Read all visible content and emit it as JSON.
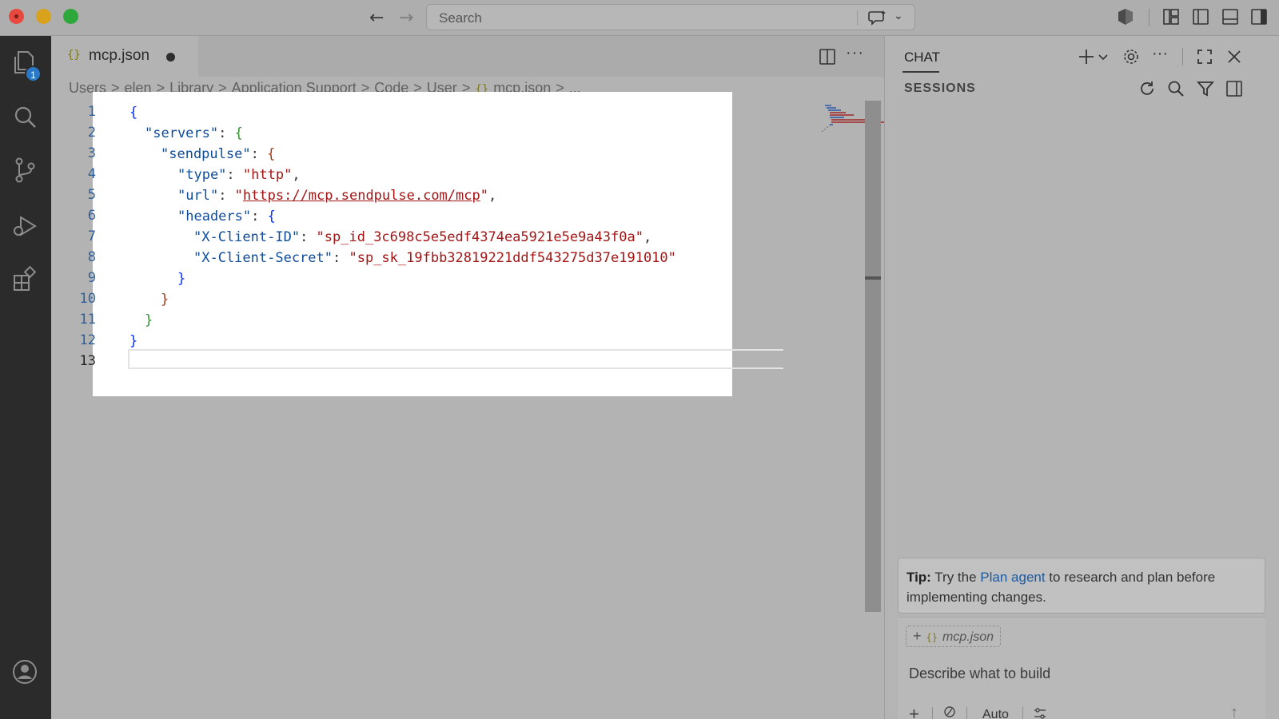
{
  "titlebar": {
    "search_placeholder": "Search",
    "back_arrow": "←",
    "forward_arrow": "→",
    "chevron": "⌄"
  },
  "activity_bar": {
    "explorer_badge": "1"
  },
  "editor": {
    "tab": {
      "icon": "{}",
      "label": "mcp.json",
      "modified_indicator": "●"
    },
    "more_actions": "···",
    "breadcrumb": {
      "items": [
        "Users",
        "elen",
        "Library",
        "Application Support",
        "Code",
        "User"
      ],
      "file_icon": "{}",
      "file": "mcp.json",
      "ellipsis": "...",
      "separator": ">"
    },
    "line_numbers": [
      "1",
      "2",
      "3",
      "4",
      "5",
      "6",
      "7",
      "8",
      "9",
      "10",
      "11",
      "12",
      "13"
    ],
    "code": {
      "servers_key": "\"servers\"",
      "sendpulse_key": "\"sendpulse\"",
      "type_key": "\"type\"",
      "type_value": "\"http\"",
      "url_key": "\"url\"",
      "url_value": "https://mcp.sendpulse.com/mcp",
      "headers_key": "\"headers\"",
      "client_id_key": "\"X-Client-ID\"",
      "client_id_value": "\"sp_id_3c698c5e5edf4374ea5921e5e9a43f0a\"",
      "client_secret_key": "\"X-Client-Secret\"",
      "client_secret_value": "\"sp_sk_19fbb32819221ddf543275d37e191010\""
    }
  },
  "chat": {
    "title": "CHAT",
    "sessions_title": "SESSIONS",
    "tip": {
      "label": "Tip:",
      "text_before": " Try the ",
      "link": "Plan agent",
      "text_after": " to research and plan before implementing changes."
    },
    "context_chip": {
      "plus": "+",
      "icon": "{}",
      "label": "mcp.json"
    },
    "input_placeholder": "Describe what to build",
    "mode_label": "Auto",
    "add_label": "+",
    "send_label": "↑"
  },
  "colors": {
    "activity_bar_bg": "#2b2b2b",
    "badge": "#2a78c8",
    "string": "#a31515",
    "key": "#0f4c9a",
    "link": "#1a5aa0"
  }
}
